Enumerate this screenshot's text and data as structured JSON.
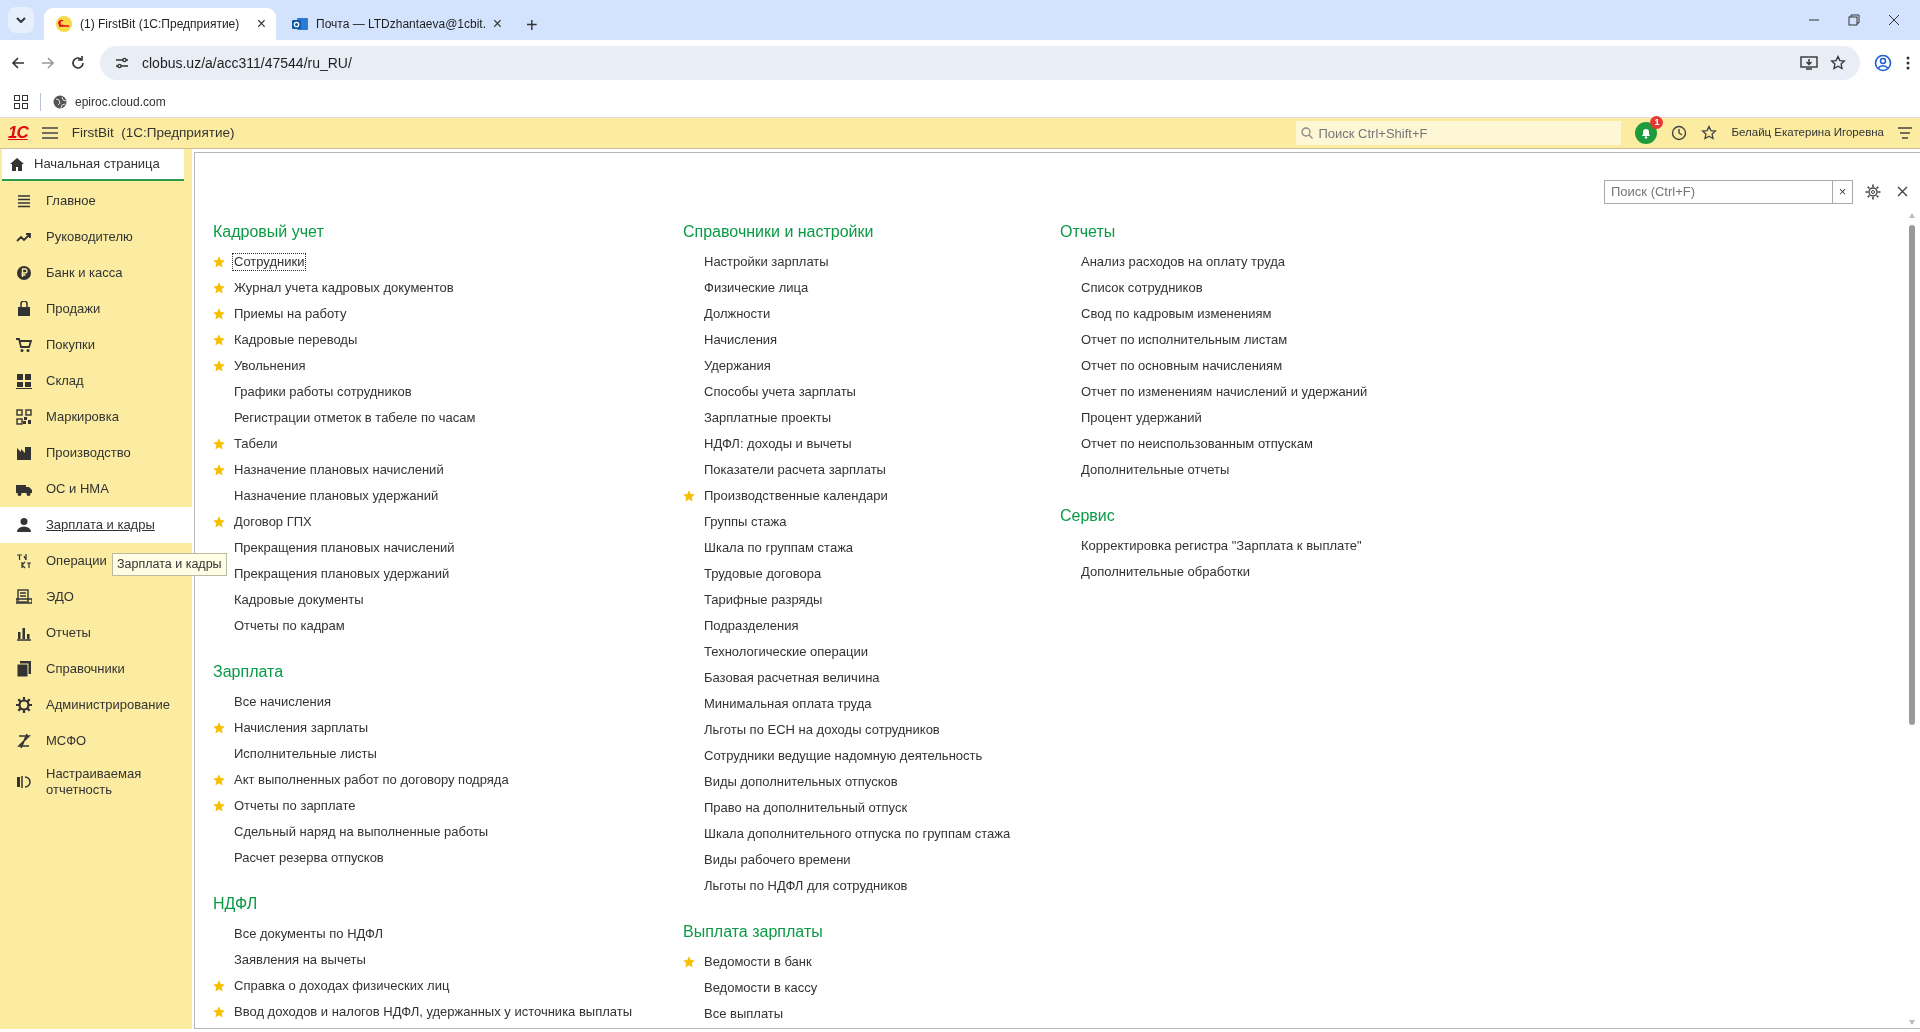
{
  "browser": {
    "tabs": [
      {
        "title": "(1) FirstBit (1С:Предприятие)",
        "selected": true,
        "close": "×"
      },
      {
        "title": "Почта — LTDzhantaeva@1cbit.",
        "selected": false,
        "close": "×"
      }
    ],
    "new_tab": "+",
    "address": "clobus.uz/a/acc311/47544/ru_RU/",
    "bookmarks": [
      "epiroc.cloud.com"
    ]
  },
  "app_header": {
    "logo": "1С",
    "title": "FirstBit  (1С:Предприятие)",
    "search": {
      "placeholder": "Поиск Ctrl+Shift+F"
    },
    "notification_count": "1",
    "user": "Белайц Екатерина Игоревна"
  },
  "home_tab": {
    "label": "Начальная страница"
  },
  "sidebar": {
    "items": [
      {
        "label": "Главное",
        "selected": false
      },
      {
        "label": "Руководителю",
        "selected": false
      },
      {
        "label": "Банк и касса",
        "selected": false
      },
      {
        "label": "Продажи",
        "selected": false
      },
      {
        "label": "Покупки",
        "selected": false
      },
      {
        "label": "Склад",
        "selected": false
      },
      {
        "label": "Маркировка",
        "selected": false
      },
      {
        "label": "Производство",
        "selected": false
      },
      {
        "label": "ОС и НМА",
        "selected": false
      },
      {
        "label": "Зарплата и кадры",
        "selected": true
      },
      {
        "label": "Операции",
        "selected": false
      },
      {
        "label": "ЭДО",
        "selected": false
      },
      {
        "label": "Отчеты",
        "selected": false
      },
      {
        "label": "Справочники",
        "selected": false
      },
      {
        "label": "Администрирование",
        "selected": false
      },
      {
        "label": "МСФО",
        "selected": false
      },
      {
        "label": "Настраиваемая отчетность",
        "selected": false
      }
    ]
  },
  "tooltip": "Зарплата и кадры",
  "panel": {
    "search": {
      "placeholder": "Поиск (Ctrl+F)",
      "clear": "×"
    },
    "columns": [
      {
        "sections": [
          {
            "title": "Кадровый учет",
            "items": [
              {
                "label": "Сотрудники",
                "starred": true,
                "focused": true
              },
              {
                "label": "Журнал учета кадровых документов",
                "starred": true,
                "focused": false
              },
              {
                "label": "Приемы на работу",
                "starred": true,
                "focused": false
              },
              {
                "label": "Кадровые переводы",
                "starred": true,
                "focused": false
              },
              {
                "label": "Увольнения",
                "starred": true,
                "focused": false
              },
              {
                "label": "Графики работы сотрудников",
                "starred": false,
                "focused": false
              },
              {
                "label": "Регистрации отметок в табеле по часам",
                "starred": false,
                "focused": false
              },
              {
                "label": "Табели",
                "starred": true,
                "focused": false
              },
              {
                "label": "Назначение плановых начислений",
                "starred": true,
                "focused": false
              },
              {
                "label": "Назначение плановых удержаний",
                "starred": false,
                "focused": false
              },
              {
                "label": "Договор ГПХ",
                "starred": true,
                "focused": false
              },
              {
                "label": "Прекращения плановых начислений",
                "starred": false,
                "focused": false
              },
              {
                "label": "Прекращения плановых удержаний",
                "starred": false,
                "focused": false
              },
              {
                "label": "Кадровые документы",
                "starred": false,
                "focused": false
              },
              {
                "label": "Отчеты по кадрам",
                "starred": false,
                "focused": false
              }
            ]
          },
          {
            "title": "Зарплата",
            "items": [
              {
                "label": "Все начисления",
                "starred": false,
                "focused": false
              },
              {
                "label": "Начисления зарплаты",
                "starred": true,
                "focused": false
              },
              {
                "label": "Исполнительные листы",
                "starred": false,
                "focused": false
              },
              {
                "label": "Акт выполненных работ по договору подряда",
                "starred": true,
                "focused": false
              },
              {
                "label": "Отчеты по зарплате",
                "starred": true,
                "focused": false
              },
              {
                "label": "Сдельный наряд на выполненные работы",
                "starred": false,
                "focused": false
              },
              {
                "label": "Расчет резерва отпусков",
                "starred": false,
                "focused": false
              }
            ]
          },
          {
            "title": "НДФЛ",
            "items": [
              {
                "label": "Все документы по НДФЛ",
                "starred": false,
                "focused": false
              },
              {
                "label": "Заявления на вычеты",
                "starred": false,
                "focused": false
              },
              {
                "label": "Справка о доходах физических лиц",
                "starred": true,
                "focused": false
              },
              {
                "label": "Ввод доходов и налогов НДФЛ, удержанных у источника выплаты",
                "starred": true,
                "focused": false
              }
            ]
          }
        ]
      },
      {
        "sections": [
          {
            "title": "Справочники и настройки",
            "items": [
              {
                "label": "Настройки зарплаты",
                "starred": false,
                "focused": false
              },
              {
                "label": "Физические лица",
                "starred": false,
                "focused": false
              },
              {
                "label": "Должности",
                "starred": false,
                "focused": false
              },
              {
                "label": "Начисления",
                "starred": false,
                "focused": false
              },
              {
                "label": "Удержания",
                "starred": false,
                "focused": false
              },
              {
                "label": "Способы учета зарплаты",
                "starred": false,
                "focused": false
              },
              {
                "label": "Зарплатные проекты",
                "starred": false,
                "focused": false
              },
              {
                "label": "НДФЛ: доходы и вычеты",
                "starred": false,
                "focused": false
              },
              {
                "label": "Показатели расчета зарплаты",
                "starred": false,
                "focused": false
              },
              {
                "label": "Производственные календари",
                "starred": true,
                "focused": false
              },
              {
                "label": "Группы стажа",
                "starred": false,
                "focused": false
              },
              {
                "label": "Шкала по группам стажа",
                "starred": false,
                "focused": false
              },
              {
                "label": "Трудовые договора",
                "starred": false,
                "focused": false
              },
              {
                "label": "Тарифные разряды",
                "starred": false,
                "focused": false
              },
              {
                "label": "Подразделения",
                "starred": false,
                "focused": false
              },
              {
                "label": "Технологические операции",
                "starred": false,
                "focused": false
              },
              {
                "label": "Базовая расчетная величина",
                "starred": false,
                "focused": false
              },
              {
                "label": "Минимальная оплата труда",
                "starred": false,
                "focused": false
              },
              {
                "label": "Льготы по ЕСН на доходы сотрудников",
                "starred": false,
                "focused": false
              },
              {
                "label": "Сотрудники ведущие надомную деятельность",
                "starred": false,
                "focused": false
              },
              {
                "label": "Виды дополнительных отпусков",
                "starred": false,
                "focused": false
              },
              {
                "label": "Право на дополнительный отпуск",
                "starred": false,
                "focused": false
              },
              {
                "label": "Шкала дополнительного отпуска по группам стажа",
                "starred": false,
                "focused": false
              },
              {
                "label": "Виды рабочего времени",
                "starred": false,
                "focused": false
              },
              {
                "label": "Льготы по НДФЛ для сотрудников",
                "starred": false,
                "focused": false
              }
            ]
          },
          {
            "title": "Выплата зарплаты",
            "items": [
              {
                "label": "Ведомости в банк",
                "starred": true,
                "focused": false
              },
              {
                "label": "Ведомости в кассу",
                "starred": false,
                "focused": false
              },
              {
                "label": "Все выплаты",
                "starred": false,
                "focused": false
              }
            ]
          }
        ]
      },
      {
        "sections": [
          {
            "title": "Отчеты",
            "items": [
              {
                "label": "Анализ расходов на оплату труда",
                "starred": false,
                "focused": false
              },
              {
                "label": "Список сотрудников",
                "starred": false,
                "focused": false
              },
              {
                "label": "Свод по кадровым изменениям",
                "starred": false,
                "focused": false
              },
              {
                "label": "Отчет по исполнительным листам",
                "starred": false,
                "focused": false
              },
              {
                "label": "Отчет по основным начислениям",
                "starred": false,
                "focused": false
              },
              {
                "label": "Отчет по изменениям начислений и удержаний",
                "starred": false,
                "focused": false
              },
              {
                "label": "Процент удержаний",
                "starred": false,
                "focused": false
              },
              {
                "label": "Отчет по неиспользованным отпускам",
                "starred": false,
                "focused": false
              },
              {
                "label": "Дополнительные отчеты",
                "starred": false,
                "focused": false
              }
            ]
          },
          {
            "title": "Сервис",
            "items": [
              {
                "label": "Корректировка регистра \"Зарплата к выплате\"",
                "starred": false,
                "focused": false
              },
              {
                "label": "Дополнительные обработки",
                "starred": false,
                "focused": false
              }
            ]
          }
        ]
      }
    ]
  }
}
